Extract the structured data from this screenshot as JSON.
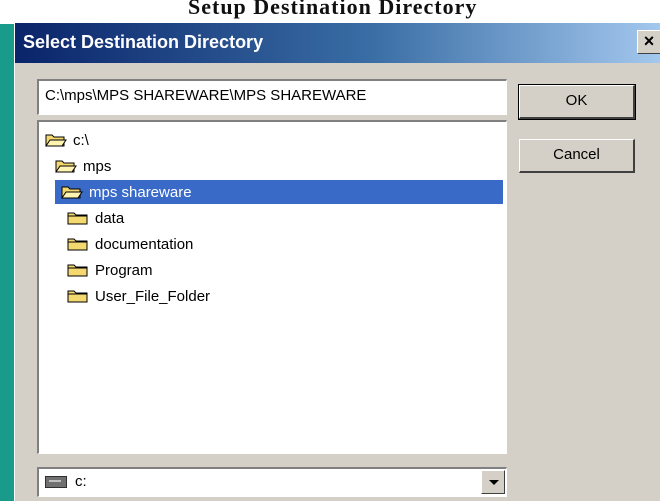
{
  "background": {
    "text": "Setup Destination Directory"
  },
  "dialog": {
    "title": "Select Destination Directory",
    "close_label": "×",
    "path_value": "C:\\mps\\MPS SHAREWARE\\MPS SHAREWARE",
    "ok_label": "OK",
    "cancel_label": "Cancel",
    "drive_label": "c:"
  },
  "tree": {
    "items": [
      {
        "label": "c:\\",
        "icon": "open-folder-icon",
        "selected": false
      },
      {
        "label": "mps",
        "icon": "open-folder-icon",
        "selected": false
      },
      {
        "label": "mps shareware",
        "icon": "open-folder-icon",
        "selected": true
      },
      {
        "label": "data",
        "icon": "folder-icon",
        "selected": false
      },
      {
        "label": "documentation",
        "icon": "folder-icon",
        "selected": false
      },
      {
        "label": "Program",
        "icon": "folder-icon",
        "selected": false
      },
      {
        "label": "User_File_Folder",
        "icon": "folder-icon",
        "selected": false
      }
    ]
  },
  "colors": {
    "titlebar_start": "#0a246a",
    "titlebar_end": "#a6caf0",
    "selection": "#3a6ac8",
    "face": "#d4d0c8",
    "folder": "#f4d870"
  }
}
